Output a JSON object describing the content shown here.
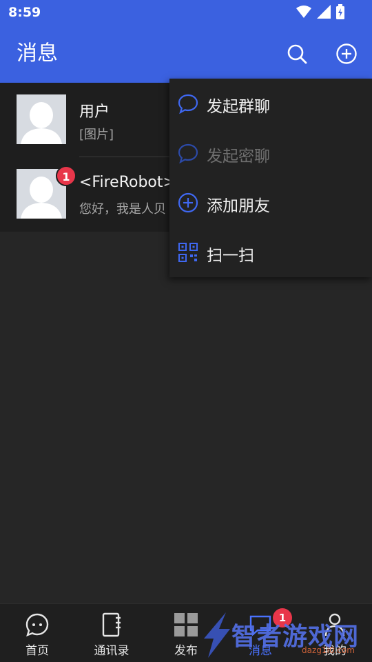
{
  "status_bar": {
    "time": "8:59"
  },
  "header": {
    "title": "消息"
  },
  "conversations": [
    {
      "name": "用户",
      "preview": "[图片]",
      "unread": null
    },
    {
      "name": "<FireRobot>",
      "preview": "您好，我是人贝",
      "unread": "1"
    }
  ],
  "popup_menu": {
    "items": [
      {
        "label": "发起群聊",
        "icon": "chat-bubble-icon",
        "enabled": true
      },
      {
        "label": "发起密聊",
        "icon": "chat-bubble-icon",
        "enabled": false
      },
      {
        "label": "添加朋友",
        "icon": "plus-circle-icon",
        "enabled": true
      },
      {
        "label": "扫一扫",
        "icon": "qr-scan-icon",
        "enabled": true
      }
    ]
  },
  "bottom_nav": {
    "items": [
      {
        "label": "首页",
        "icon": "chat-dots-icon"
      },
      {
        "label": "通讯录",
        "icon": "notebook-icon"
      },
      {
        "label": "发布",
        "icon": "grid-icon"
      },
      {
        "label": "消息",
        "icon": "message-icon",
        "badge": "1",
        "active": true
      },
      {
        "label": "我的",
        "icon": "person-icon"
      }
    ]
  },
  "watermark": {
    "text": "智者游戏网",
    "sub": "dazg1i0.com"
  },
  "colors": {
    "primary": "#3b61e0",
    "accent": "#4a72ff",
    "badge": "#e8364a",
    "background": "#262626"
  }
}
